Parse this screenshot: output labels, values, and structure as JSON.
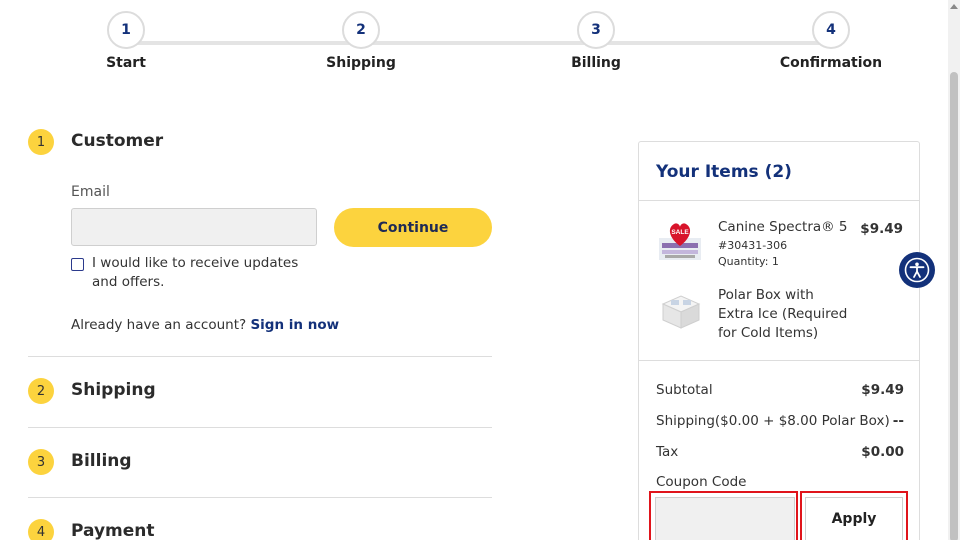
{
  "stepper": {
    "steps": [
      {
        "number": "1",
        "label": "Start"
      },
      {
        "number": "2",
        "label": "Shipping"
      },
      {
        "number": "3",
        "label": "Billing"
      },
      {
        "number": "4",
        "label": "Confirmation"
      }
    ]
  },
  "sections": [
    {
      "number": "1",
      "title": "Customer"
    },
    {
      "number": "2",
      "title": "Shipping"
    },
    {
      "number": "3",
      "title": "Billing"
    },
    {
      "number": "4",
      "title": "Payment"
    }
  ],
  "customer": {
    "email_label": "Email",
    "email_value": "",
    "continue_label": "Continue",
    "optin_label": "I would like to receive updates and offers.",
    "optin_checked": false,
    "account_prompt": "Already have an account?",
    "signin_label": "Sign in now"
  },
  "summary": {
    "title": "Your Items (2)",
    "items": [
      {
        "name": "Canine Spectra® 5",
        "sku": "#30431-306",
        "quantity": "Quantity: 1",
        "price": "$9.49",
        "badge": "SALE",
        "icon": "heart-sale-badge"
      },
      {
        "name": "Polar Box with Extra Ice (Required for Cold Items)",
        "icon": "polar-box-image"
      }
    ],
    "subtotal_label": "Subtotal",
    "subtotal_value": "$9.49",
    "shipping_label": "Shipping($0.00 + $8.00 Polar Box)",
    "shipping_value": "--",
    "tax_label": "Tax",
    "tax_value": "$0.00",
    "coupon_label": "Coupon Code",
    "coupon_value": "",
    "apply_label": "Apply"
  },
  "colors": {
    "accent_yellow": "#fcd33e",
    "brand_navy": "#13317a",
    "highlight_red": "#e0141b"
  }
}
